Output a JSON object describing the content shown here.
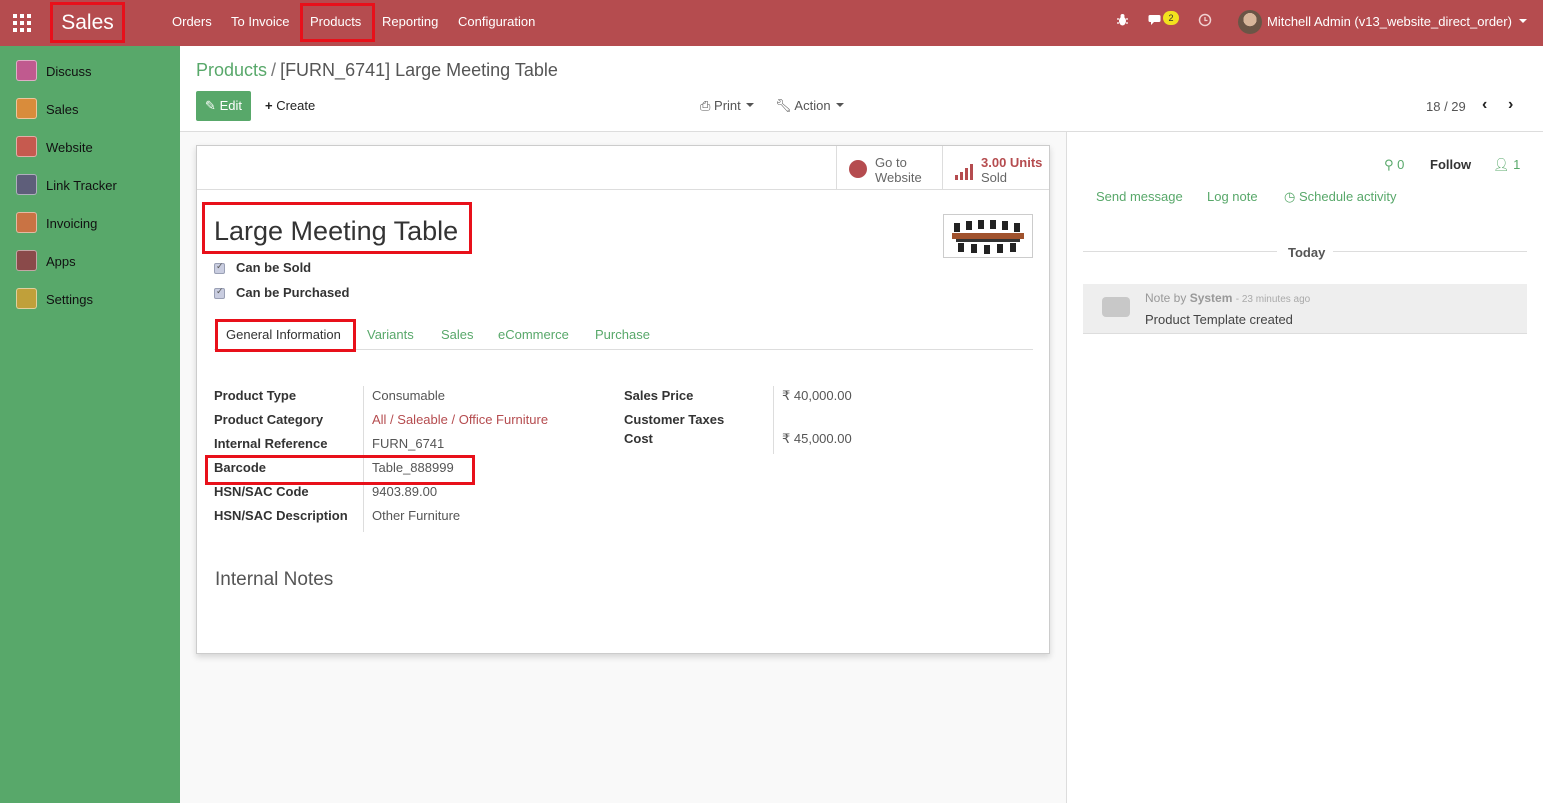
{
  "navbar": {
    "app_name": "Sales",
    "menu": [
      "Orders",
      "To Invoice",
      "Products",
      "Reporting",
      "Configuration"
    ],
    "messages_count": "2",
    "user_name": "Mitchell Admin (v13_website_direct_order)"
  },
  "sidebar": {
    "items": [
      {
        "label": "Discuss",
        "color": "#c05a8f"
      },
      {
        "label": "Sales",
        "color": "#d98c3b"
      },
      {
        "label": "Website",
        "color": "#c65a4f"
      },
      {
        "label": "Link Tracker",
        "color": "#5e5e7a"
      },
      {
        "label": "Invoicing",
        "color": "#c97344"
      },
      {
        "label": "Apps",
        "color": "#8a4a4a"
      },
      {
        "label": "Settings",
        "color": "#c0a03a"
      }
    ]
  },
  "control": {
    "breadcrumb_parent": "Products",
    "breadcrumb_separator": "/",
    "breadcrumb_current": "[FURN_6741] Large Meeting Table",
    "edit_label": "Edit",
    "create_label": "Create",
    "print_label": "Print",
    "action_label": "Action",
    "pager": "18 / 29"
  },
  "stat_buttons": {
    "website_line1": "Go to",
    "website_line2": "Website",
    "sold_value": "3.00 Units",
    "sold_label": "Sold"
  },
  "product": {
    "name": "Large Meeting Table",
    "can_be_sold_label": "Can be Sold",
    "can_be_sold": true,
    "can_be_purchased_label": "Can be Purchased",
    "can_be_purchased": true
  },
  "tabs": [
    "General Information",
    "Variants",
    "Sales",
    "eCommerce",
    "Purchase"
  ],
  "general_info": {
    "left": [
      {
        "label": "Product Type",
        "value": "Consumable"
      },
      {
        "label": "Product Category",
        "value": "All / Saleable / Office Furniture"
      },
      {
        "label": "Internal Reference",
        "value": "FURN_6741"
      },
      {
        "label": "Barcode",
        "value": "Table_888999"
      },
      {
        "label": "HSN/SAC Code",
        "value": "9403.89.00"
      },
      {
        "label": "HSN/SAC Description",
        "value": "Other Furniture"
      }
    ],
    "right": [
      {
        "label": "Sales Price",
        "value": "₹ 40,000.00"
      },
      {
        "label": "Customer Taxes",
        "value": ""
      },
      {
        "label": "Cost",
        "value": "₹ 45,000.00"
      }
    ],
    "notes_title": "Internal Notes"
  },
  "chatter": {
    "attachments": "0",
    "follow_label": "Follow",
    "followers": "1",
    "send_message": "Send message",
    "log_note": "Log note",
    "schedule_activity": "Schedule activity",
    "today_label": "Today",
    "note_prefix": "Note by",
    "note_author": "System",
    "note_time": "- 23 minutes ago",
    "note_body": "Product Template created"
  }
}
